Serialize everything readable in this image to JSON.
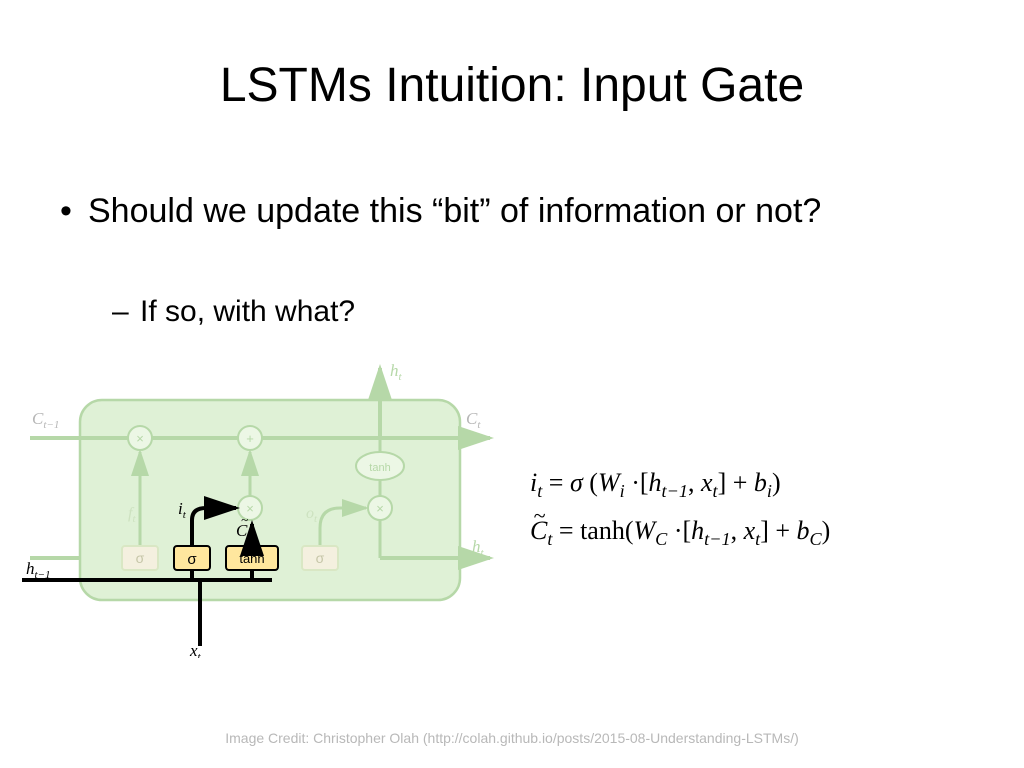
{
  "title": "LSTMs Intuition: Input Gate",
  "bullets": {
    "main": "Should we update this “bit” of information or not?",
    "sub": "If so, with what?"
  },
  "diagram": {
    "labels": {
      "c_prev": "C",
      "c_prev_sub": "t−1",
      "c_next": "C",
      "c_next_sub": "t",
      "h_prev": "h",
      "h_prev_sub": "t−1",
      "h_out_top": "h",
      "h_out_top_sub": "t",
      "h_out_right": "h",
      "h_out_right_sub": "t",
      "x_in": "x",
      "x_in_sub": "t",
      "f_gate": "f",
      "f_gate_sub": "t",
      "i_gate": "i",
      "i_gate_sub": "t",
      "c_tilde": "C",
      "c_tilde_sub": "t",
      "o_gate": "o",
      "o_gate_sub": "t",
      "sigma": "σ",
      "tanh": "tanh",
      "times": "×",
      "plus": "+"
    }
  },
  "equations": {
    "row1_parts": {
      "i": "i",
      "tsub": "t",
      "eq": " = ",
      "sigma": "σ",
      "lp": " (",
      "W": "W",
      "isub": "i",
      "dot": " ·",
      "lb": "[",
      "h": "h",
      "hsub": "t−1",
      "comma": ", ",
      "x": "x",
      "xsub": "t",
      "rb": "]",
      "sp": "  +  ",
      "b": "b",
      "bsub": "i",
      "rp": ")"
    },
    "row2_parts": {
      "C": "C",
      "tsub": "t",
      "eq": " = tanh(",
      "W": "W",
      "Csub": "C",
      "dot": " ·",
      "lb": "[",
      "h": "h",
      "hsub": "t−1",
      "comma": ", ",
      "x": "x",
      "xsub": "t",
      "rb": "]",
      "sp": "  +  ",
      "b": "b",
      "bsub": "C",
      "rp": ")"
    }
  },
  "credit": "Image Credit: Christopher Olah (http://colah.github.io/posts/2015-08-Understanding-LSTMs/)"
}
